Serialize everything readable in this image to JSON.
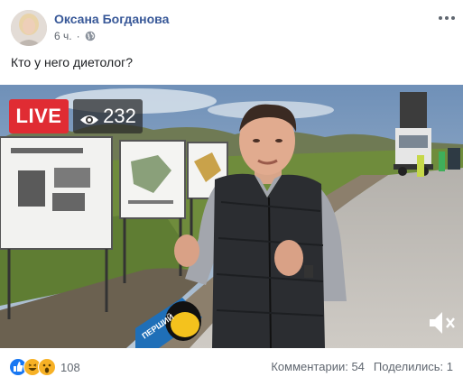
{
  "post": {
    "author_name": "Оксана Богданова",
    "timestamp": "6 ч.",
    "separator": "·",
    "privacy_icon": "globe-icon",
    "text": "Кто у него диетолог?"
  },
  "video": {
    "live_label": "LIVE",
    "viewer_count": "232",
    "viewer_icon": "eye-icon",
    "mute_icon": "speaker-muted-icon",
    "mic_sign_text": "ПЕРШИЙ"
  },
  "footer": {
    "reaction_icons": [
      "like-icon",
      "haha-icon",
      "wow-icon"
    ],
    "reaction_count": "108",
    "comments_label": "Комментарии: 54",
    "shares_label": "Поделились: 1"
  },
  "colors": {
    "author_link": "#385898",
    "live_red": "#e02c33",
    "like_blue": "#1877f2",
    "secondary_text": "#606770"
  }
}
